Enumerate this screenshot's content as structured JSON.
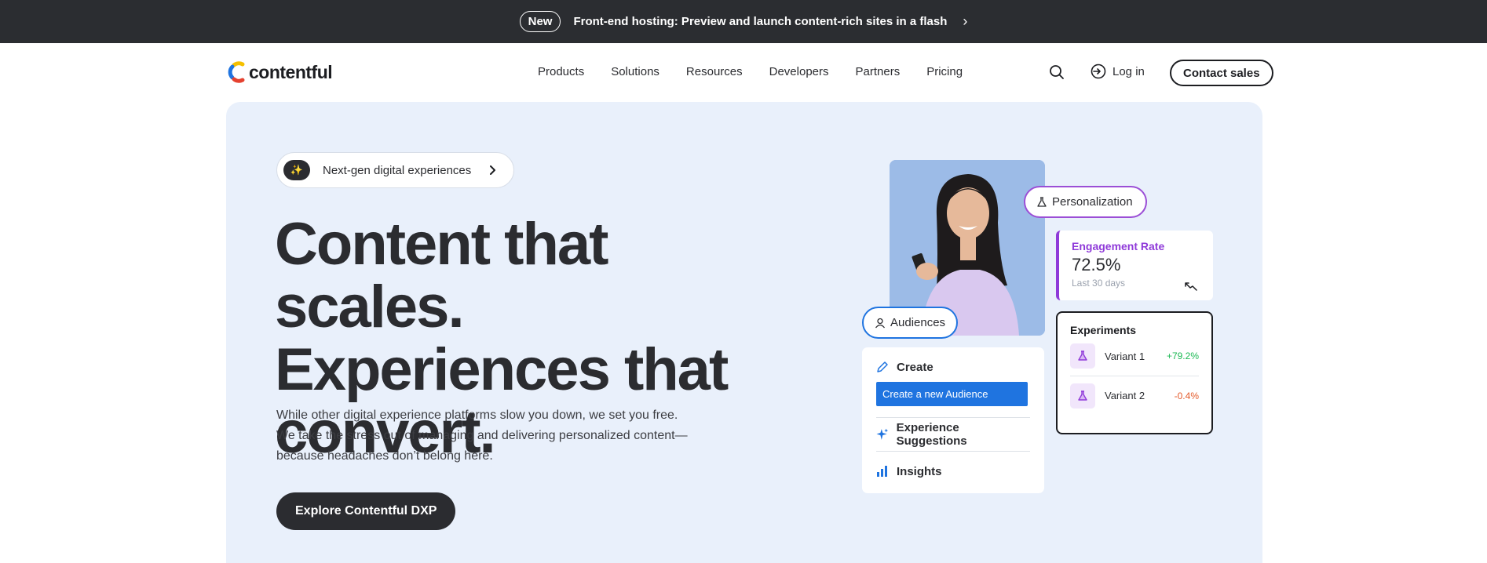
{
  "announcement": {
    "badge": "New",
    "message": "Front-end hosting: Preview and launch content-rich sites in a flash",
    "chevron": "›"
  },
  "nav": {
    "logo_text": "contentful",
    "links": [
      "Products",
      "Solutions",
      "Resources",
      "Developers",
      "Partners",
      "Pricing"
    ],
    "search_icon": "search-icon",
    "login_label": "Log in",
    "contact_label": "Contact sales"
  },
  "hero": {
    "pill_text": "Next-gen digital experiences",
    "pill_icon": "✨",
    "headline": [
      "Content that scales.",
      "Experiences that",
      "convert."
    ],
    "subtext": [
      "While other digital experience platforms slow you down, we set you free.",
      "We take the stress out of managing and delivering personalized content—",
      "because headaches don’t belong here."
    ],
    "cta_label": "Explore Contentful DXP"
  },
  "illustration": {
    "personalization_tag": "Personalization",
    "audiences_tag": "Audiences",
    "engagement": {
      "label": "Engagement Rate",
      "value": "72.5%",
      "period": "Last 30 days"
    },
    "experiments": {
      "title": "Experiments",
      "variants": [
        {
          "name": "Variant 1",
          "change": "+79.2%"
        },
        {
          "name": "Variant 2",
          "change": "-0.4%"
        }
      ]
    },
    "menu": {
      "create_label": "Create",
      "create_button": "Create a new Audience",
      "suggestions_label": "Experience Suggestions",
      "insights_label": "Insights"
    }
  },
  "colors": {
    "announce_bg": "#2b2d31",
    "hero_bg": "#e9f0fb",
    "purple": "#8f3ad9",
    "blue": "#1f74e0",
    "positive": "#1db954",
    "negative": "#e45a2a"
  }
}
